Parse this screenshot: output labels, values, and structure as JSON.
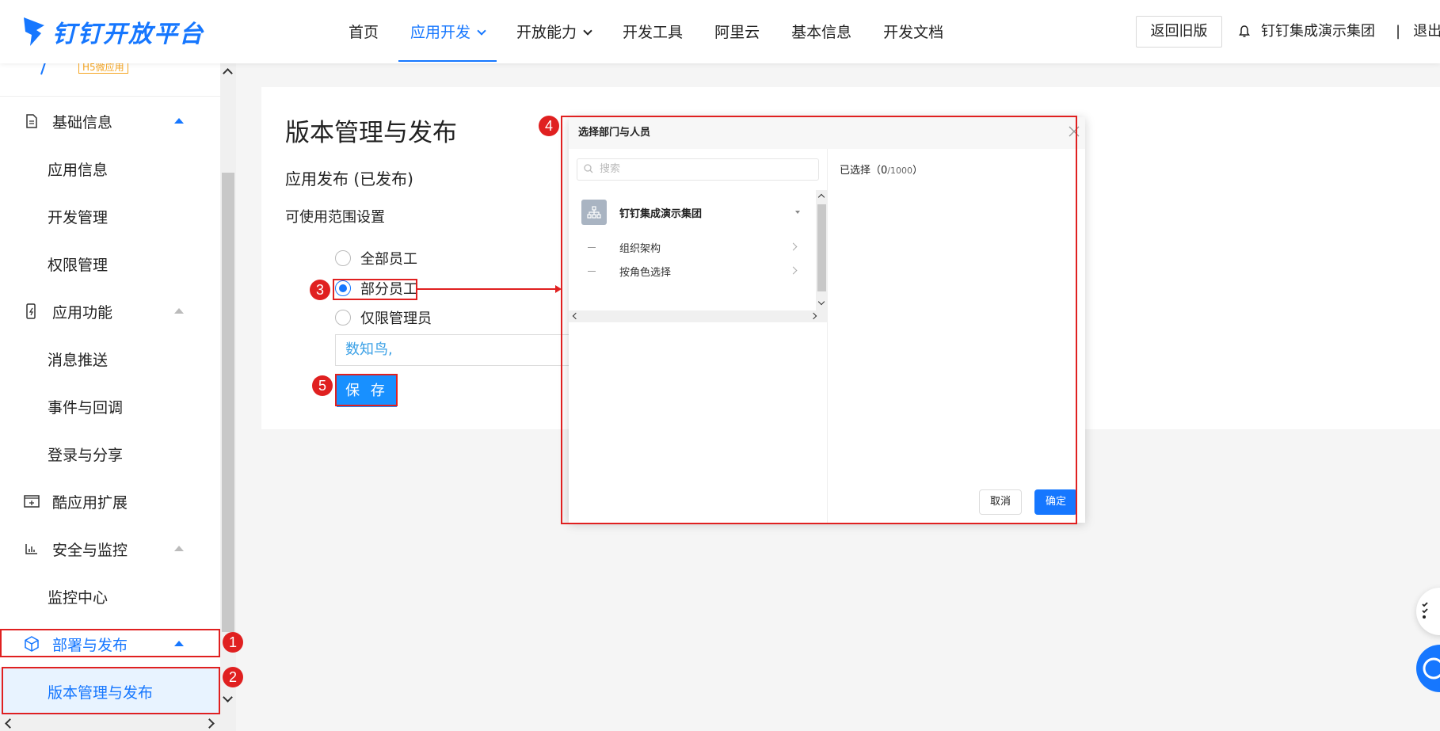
{
  "header": {
    "logo_text": "钉钉开放平台",
    "nav": [
      {
        "label": "首页"
      },
      {
        "label": "应用开发"
      },
      {
        "label": "开放能力"
      },
      {
        "label": "开发工具"
      },
      {
        "label": "阿里云"
      },
      {
        "label": "基本信息"
      },
      {
        "label": "开发文档"
      }
    ],
    "old_version_btn": "返回旧版",
    "org_name": "钉钉集成演示集团",
    "separator": "|",
    "logout": "退出"
  },
  "sidebar": {
    "h5_tag": "H5微应用",
    "items": [
      {
        "label": "基础信息"
      },
      {
        "label": "应用信息"
      },
      {
        "label": "开发管理"
      },
      {
        "label": "权限管理"
      },
      {
        "label": "应用功能"
      },
      {
        "label": "消息推送"
      },
      {
        "label": "事件与回调"
      },
      {
        "label": "登录与分享"
      },
      {
        "label": "酷应用扩展"
      },
      {
        "label": "安全与监控"
      },
      {
        "label": "监控中心"
      },
      {
        "label": "部署与发布"
      },
      {
        "label": "版本管理与发布"
      }
    ]
  },
  "main": {
    "title": "版本管理与发布",
    "section_title": "应用发布 (已发布)",
    "scope_title": "可使用范围设置",
    "radios": [
      {
        "label": "全部员工"
      },
      {
        "label": "部分员工"
      },
      {
        "label": "仅限管理员"
      }
    ],
    "scope_value": "数知鸟,",
    "save_label": "保 存"
  },
  "modal": {
    "title": "选择部门与人员",
    "search_placeholder": "搜索",
    "root_org": "钉钉集成演示集团",
    "rows": [
      {
        "label": "组织架构"
      },
      {
        "label": "按角色选择"
      }
    ],
    "selected_prefix": "已选择（",
    "selected_count": "0",
    "selected_max": "/1000",
    "selected_suffix": "）",
    "cancel_label": "取消",
    "ok_label": "确定"
  },
  "annotations": [
    "1",
    "2",
    "3",
    "4",
    "5"
  ],
  "colors": {
    "accent": "#1677ff",
    "annotation": "#e02020"
  }
}
